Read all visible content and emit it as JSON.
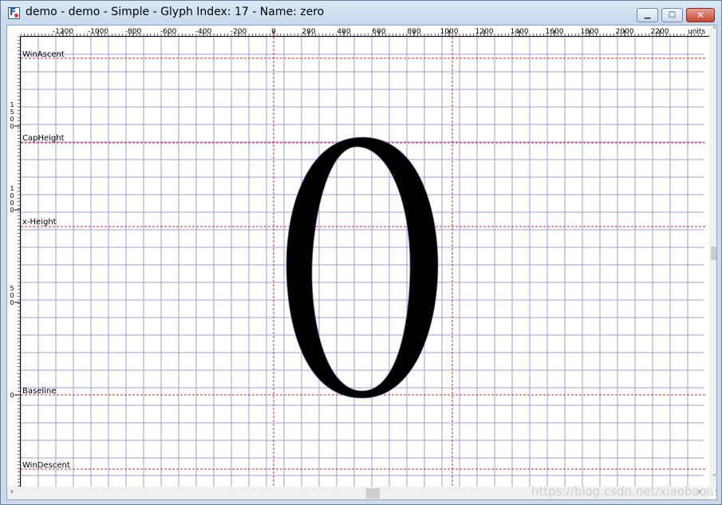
{
  "window": {
    "title": "demo - demo - Simple - Glyph Index: 17 - Name: zero",
    "buttons": {
      "minimize": "▁",
      "maximize": "▢",
      "close": "✕"
    }
  },
  "ruler": {
    "units_label": "units",
    "x_ticks": [
      "-1200",
      "-1000",
      "-800",
      "-600",
      "-400",
      "-200",
      "0",
      "200",
      "400",
      "600",
      "800",
      "1000",
      "1200",
      "1400",
      "1600",
      "1800",
      "2000",
      "2200"
    ],
    "y_ticks": [
      "1500",
      "1000",
      "500",
      "0"
    ]
  },
  "guides": {
    "win_ascent": "WinAscent",
    "cap_height": "CapHeight",
    "x_height": "x-Height",
    "baseline": "Baseline",
    "win_descent": "WinDescent"
  },
  "glyph": {
    "character": "0",
    "name": "zero",
    "index": 17
  },
  "colors": {
    "grid": "#a39ae6",
    "guide": "#cc2a2a",
    "glyph": "#000000"
  },
  "watermark": "https://blog.csdn.net/xiaobaoasdfex"
}
